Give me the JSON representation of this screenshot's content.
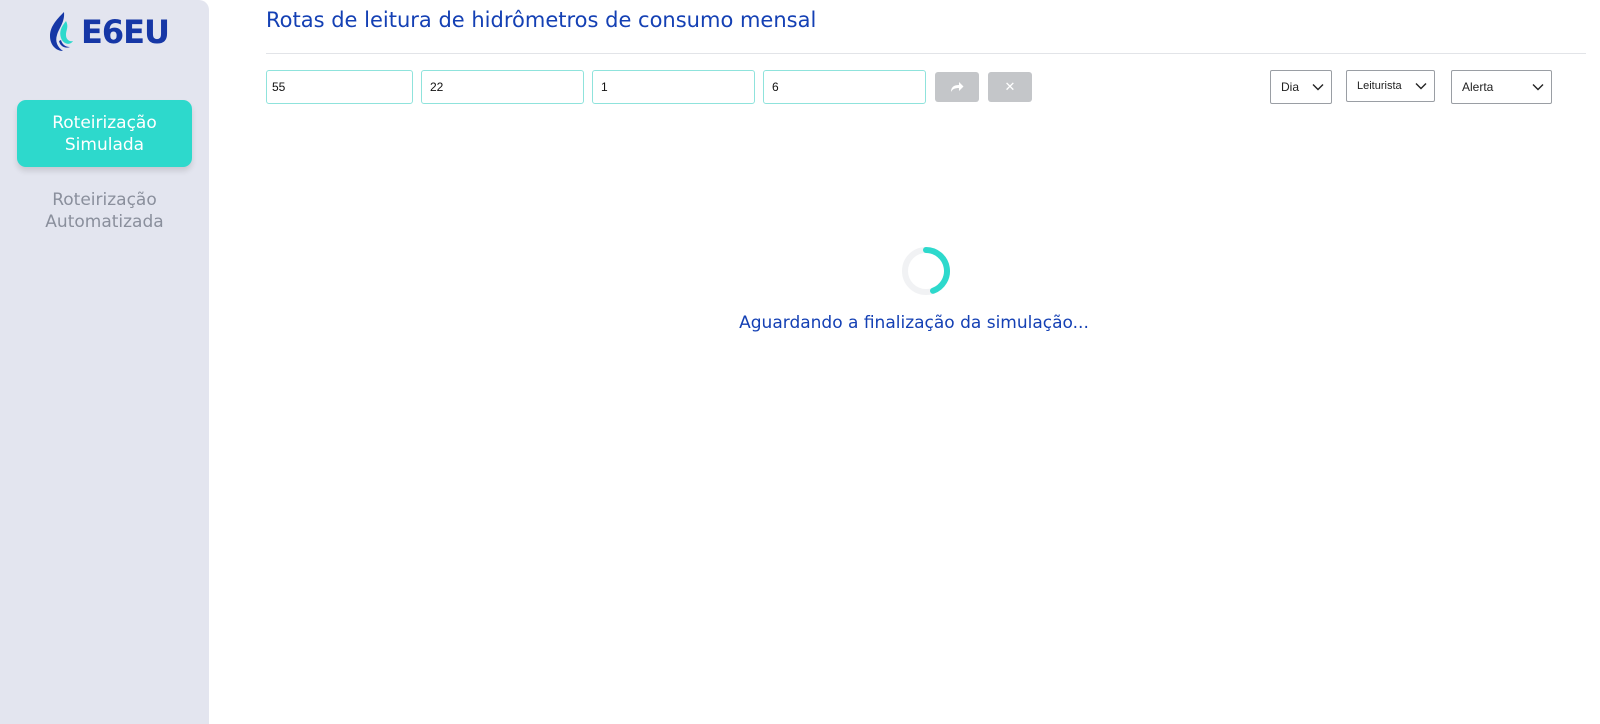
{
  "brand": {
    "name": "E6EU",
    "colors": {
      "primary": "#1637a6",
      "accent": "#2dd9cc"
    }
  },
  "sidebar": {
    "items": [
      {
        "label": "Roteirização Simulada",
        "active": true
      },
      {
        "label": "Roteirização Automatizada",
        "active": false
      }
    ]
  },
  "header": {
    "title": "Rotas de leitura de hidrômetros de consumo mensal"
  },
  "filters": {
    "inputs": [
      {
        "value": "55"
      },
      {
        "value": "22"
      },
      {
        "value": "1"
      },
      {
        "value": "6"
      }
    ],
    "buttons": {
      "apply_icon": "share-arrow-icon",
      "clear_icon": "close-icon",
      "clear_glyph": "✕"
    },
    "selects": [
      {
        "value": "Dia"
      },
      {
        "value": "Leiturista"
      },
      {
        "value": "Alerta"
      }
    ]
  },
  "status": {
    "message": "Aguardando a finalização da simulação..."
  }
}
